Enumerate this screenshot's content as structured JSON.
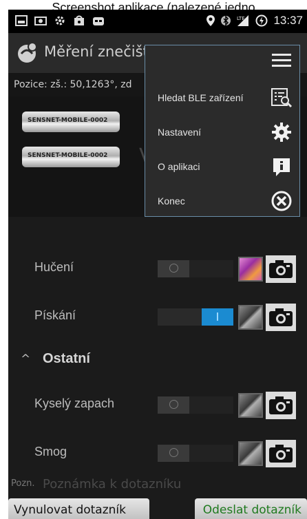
{
  "caption": "Screenshot aplikace (nalezené jedno",
  "statusbar": {
    "time": "13:37",
    "network": "LTE"
  },
  "app": {
    "title": "Měření znečišt"
  },
  "position": {
    "text": "Pozice:  zš.: 50,1263°, zd"
  },
  "devices": [
    {
      "name": "SENSNET-MOBILE-0002"
    },
    {
      "name": "SENSNET-MOBILE-0002"
    }
  ],
  "dim_letter": "V",
  "rows": [
    {
      "label": "Hučení",
      "on": false
    },
    {
      "label": "Pískání",
      "on": true
    }
  ],
  "section": {
    "title": "Ostatní",
    "arrow": "^"
  },
  "rows2": [
    {
      "label": "Kyselý zapach",
      "on": false
    },
    {
      "label": "Smog",
      "on": false
    }
  ],
  "note": {
    "label": "Pozn.",
    "placeholder": "Poznámka k dotazníku"
  },
  "buttons": {
    "reset": "Vynulovat dotazník",
    "send": "Odeslat dotazník"
  },
  "menu": {
    "items": [
      {
        "label": "Hledat BLE zařízení",
        "icon": "ble-search-icon"
      },
      {
        "label": "Nastavení",
        "icon": "gear-icon"
      },
      {
        "label": "O aplikaci",
        "icon": "info-icon"
      },
      {
        "label": "Konec",
        "icon": "close-circle-icon"
      }
    ]
  },
  "colors": {
    "accent": "#1b8bd1",
    "send_text": "#1f7a1f",
    "menu_border": "#6a8ea8"
  }
}
